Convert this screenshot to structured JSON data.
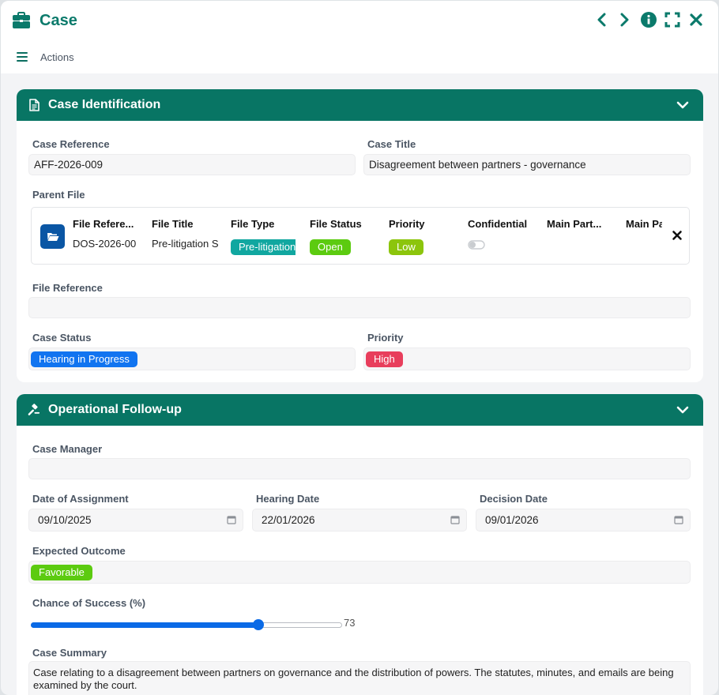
{
  "window": {
    "title": "Case",
    "icon": "briefcase-icon",
    "accent_color": "#087564"
  },
  "actions": {
    "label": "Actions"
  },
  "case_identification": {
    "header": "Case Identification",
    "case_reference_label": "Case Reference",
    "case_reference_value": "AFF-2026-009",
    "case_title_label": "Case Title",
    "case_title_value": "Disagreement between partners - governance",
    "parent_file_label": "Parent File",
    "parent_file": {
      "columns": [
        "File Refere...",
        "File Title",
        "File Type",
        "File Status",
        "Priority",
        "Confidential",
        "Main Part...",
        "Main Pa"
      ],
      "file_reference": "DOS-2026-00",
      "file_title": "Pre-litigation S",
      "file_type": "Pre-litigation",
      "file_status": "Open",
      "priority": "Low",
      "confidential": false
    },
    "file_reference_label": "File Reference",
    "file_reference_value": "",
    "case_status_label": "Case Status",
    "case_status_value": "Hearing in Progress",
    "priority_label": "Priority",
    "priority_value": "High"
  },
  "operational": {
    "header": "Operational Follow-up",
    "case_manager_label": "Case Manager",
    "case_manager_value": "",
    "date_assignment_label": "Date of Assignment",
    "date_assignment_value": "09/10/2025",
    "hearing_date_label": "Hearing Date",
    "hearing_date_value": "22/01/2026",
    "decision_date_label": "Decision Date",
    "decision_date_value": "09/01/2026",
    "expected_outcome_label": "Expected Outcome",
    "expected_outcome_value": "Favorable",
    "chance_label": "Chance of Success (%)",
    "chance_value": 73,
    "case_summary_label": "Case Summary",
    "case_summary_value": "Case relating to a disagreement between partners on governance and the distribution of powers. The statutes, minutes, and emails are being examined by the court."
  },
  "colors": {
    "teal_badge": "#11a7a0",
    "green_badge": "#5ccb10",
    "blue_badge": "#1174f0",
    "red_badge": "#e83e5c",
    "slider_blue": "#0a6ae6"
  }
}
